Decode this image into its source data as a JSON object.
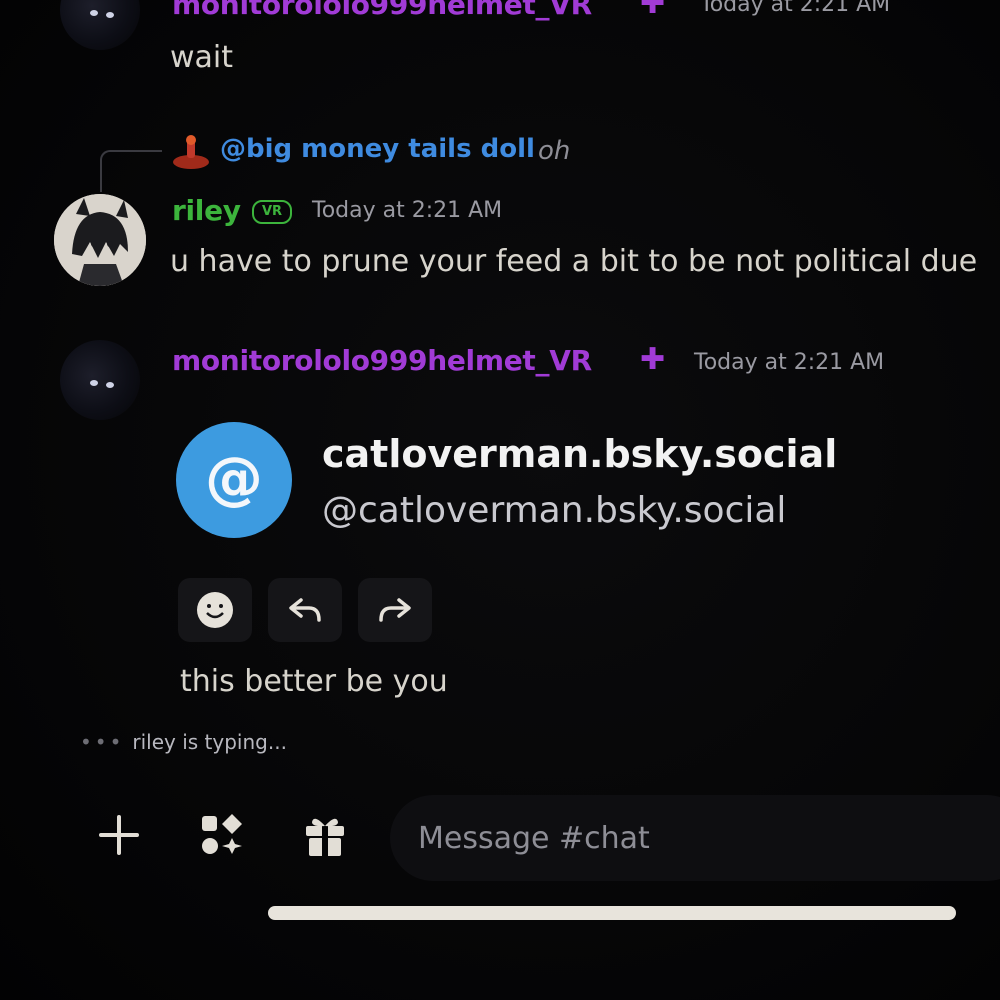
{
  "messages": {
    "top": {
      "username": "monitorololo999helmet_VR",
      "timestamp": "Today at 2:21 AM",
      "text": "wait"
    },
    "riley": {
      "reply_to_user": "@big money tails doll",
      "reply_preview": "oh",
      "username": "riley",
      "badge": "VR",
      "timestamp": "Today at 2:21 AM",
      "text": "u have to prune your feed a bit to be not political due"
    },
    "monitor": {
      "username": "monitorololo999helmet_VR",
      "timestamp": "Today at 2:21 AM",
      "embed": {
        "icon_glyph": "@",
        "title": "catloverman.bsky.social",
        "handle": "@catloverman.bsky.social"
      },
      "text": "this better be you"
    }
  },
  "typing_indicator": {
    "dots": "•••",
    "text": "riley is typing..."
  },
  "composer": {
    "placeholder": "Message #chat"
  },
  "colors": {
    "purple_username": "#a13bd6",
    "green_username": "#3cb43c",
    "mention_blue": "#3f8be0",
    "embed_blue": "#3d9be0"
  }
}
